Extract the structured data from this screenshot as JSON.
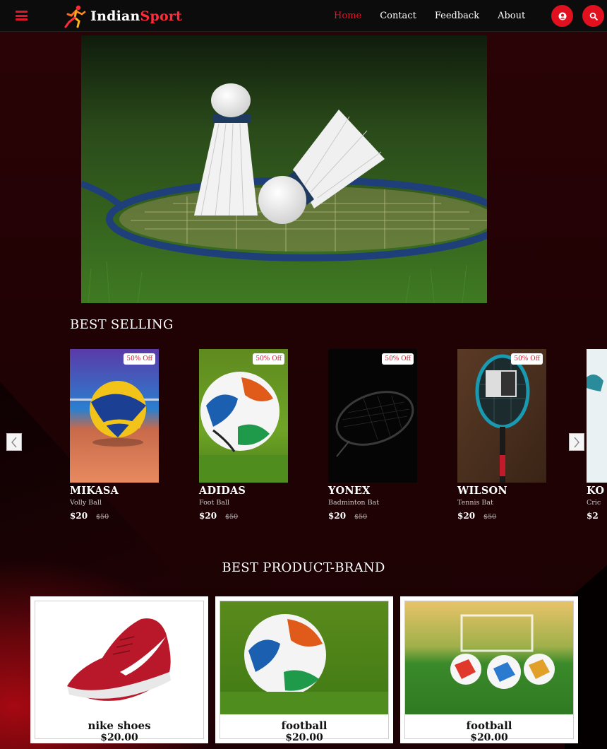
{
  "nav": {
    "logo_main": "Indian",
    "logo_accent": "Sport",
    "links": [
      "Home",
      "Contact",
      "Feedback",
      "About"
    ],
    "active_link": "Home"
  },
  "best_selling": {
    "title": "BEST SELLING",
    "items": [
      {
        "brand": "MIKASA",
        "category": "Volly Ball",
        "price": "$20",
        "old_price": "$50",
        "badge": "50% Off"
      },
      {
        "brand": "ADIDAS",
        "category": "Foot Ball",
        "price": "$20",
        "old_price": "$50",
        "badge": "50% Off"
      },
      {
        "brand": "YONEX",
        "category": "Badminton Bat",
        "price": "$20",
        "old_price": "$50",
        "badge": "50% Off"
      },
      {
        "brand": "WILSON",
        "category": "Tennis Bat",
        "price": "$20",
        "old_price": "$50",
        "badge": "50% Off"
      },
      {
        "brand": "KO",
        "category": "Cric",
        "price": "$2",
        "old_price": "",
        "badge": ""
      }
    ]
  },
  "brands": {
    "title": "BEST PRODUCT-BRAND",
    "items": [
      {
        "name": "nike shoes",
        "price": "$20.00"
      },
      {
        "name": "football",
        "price": "$20.00"
      },
      {
        "name": "football",
        "price": "$20.00"
      }
    ]
  },
  "colors": {
    "accent": "#e0162b",
    "navbar": "#0c0c0c",
    "background": "#2a0306"
  },
  "icons": [
    "menu-icon",
    "user-icon",
    "search-icon",
    "chevron-left-icon",
    "chevron-right-icon"
  ]
}
